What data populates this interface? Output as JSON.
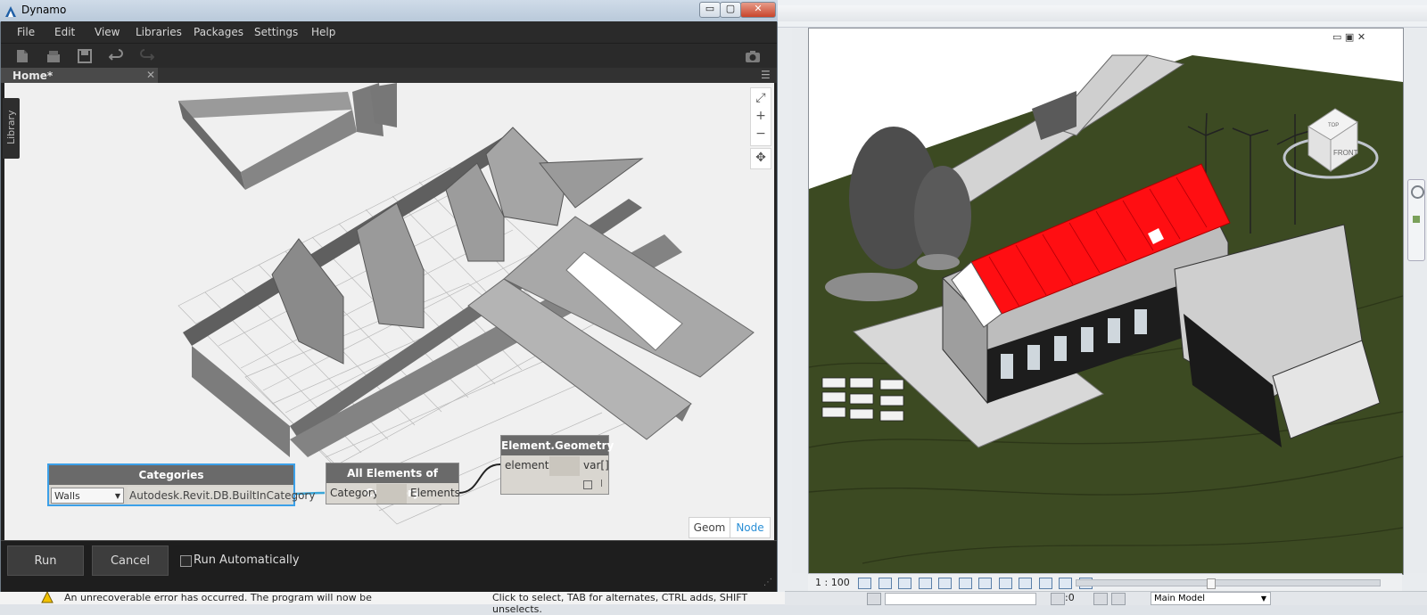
{
  "dynamo": {
    "window_title": "Dynamo",
    "window_controls": {
      "minimize": "▭",
      "maximize": "▢",
      "close": "✕"
    },
    "menu": [
      "File",
      "Edit",
      "View",
      "Libraries",
      "Packages",
      "Settings",
      "Help"
    ],
    "toolbar_icons": [
      "new-file-icon",
      "open-file-icon",
      "save-icon",
      "undo-icon",
      "redo-icon",
      "camera-icon"
    ],
    "tab": {
      "label": "Home*",
      "close": "✕",
      "menu": "☰"
    },
    "library_label": "Library",
    "navigation": {
      "fit": "⤢",
      "zoom_in": "+",
      "zoom_out": "−",
      "pan": "✥"
    },
    "view_toggle": {
      "geom": "Geom",
      "node": "Node",
      "active": "Node"
    },
    "nodes": {
      "categories": {
        "title": "Categories",
        "dropdown_value": "Walls",
        "output": "Autodesk.Revit.DB.BuiltInCategory"
      },
      "all_elements": {
        "title": "All Elements of Category",
        "input": "Category",
        "output": "Elements"
      },
      "geometry": {
        "title": "Element.Geometry",
        "input": "element",
        "output": "var[]"
      }
    },
    "run_bar": {
      "run": "Run",
      "cancel": "Cancel",
      "auto_label": "Run Automatically",
      "auto_checked": false
    }
  },
  "revit": {
    "view_controls": [
      "▭",
      "▣",
      "✕"
    ],
    "viewcube_labels": {
      "top": "TOP",
      "front": "FRONT"
    },
    "scale": "1 : 100",
    "status_filter": ":0",
    "model_selector": "Main Model",
    "colors": {
      "roof": "#ff0e12",
      "ground": "#3c4a22"
    }
  },
  "error_message": "An unrecoverable error has occurred.  The program will now be",
  "status_hint": "Click to select, TAB for alternates, CTRL adds, SHIFT unselects."
}
